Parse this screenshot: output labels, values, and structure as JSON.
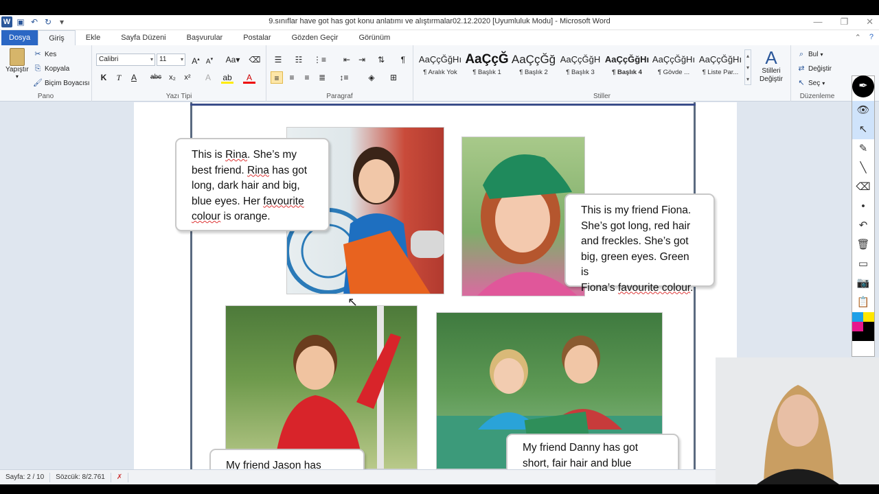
{
  "window": {
    "title": "9.sınıflar have got has got konu anlatımı ve alıştırmalar02.12.2020 [Uyumluluk Modu] - Microsoft Word"
  },
  "tabs": [
    "Dosya",
    "Giriş",
    "Ekle",
    "Sayfa Düzeni",
    "Başvurular",
    "Postalar",
    "Gözden Geçir",
    "Görünüm"
  ],
  "clipboard": {
    "paste": "Yapıştır",
    "cut": "Kes",
    "copy": "Kopyala",
    "format_painter": "Biçim Boyacısı",
    "label": "Pano"
  },
  "font": {
    "name": "Calibri",
    "size": "11",
    "label": "Yazı Tipi"
  },
  "paragraph": {
    "label": "Paragraf"
  },
  "styles": {
    "label": "Stiller",
    "items": [
      {
        "sample": "AaÇçĞğHı",
        "name": "¶ Aralık Yok"
      },
      {
        "sample": "AaÇçĞ",
        "name": "¶ Başlık 1"
      },
      {
        "sample": "AaÇçĞğ",
        "name": "¶ Başlık 2"
      },
      {
        "sample": "AaÇçĞğH",
        "name": "¶ Başlık 3"
      },
      {
        "sample": "AaÇçĞğHı",
        "name": "¶ Başlık 4"
      },
      {
        "sample": "AaÇçĞğHı",
        "name": "¶ Gövde ..."
      },
      {
        "sample": "AaÇçĞğHı",
        "name": "¶ Liste Par..."
      }
    ],
    "change_styles": "Stilleri Değiştir"
  },
  "editing": {
    "find": "Bul",
    "replace": "Değiştir",
    "select": "Seç",
    "label": "Düzenleme"
  },
  "document": {
    "rina": {
      "lines": [
        "This is Rina. She’s my",
        "best friend. Rina has got",
        "long, dark hair and big,",
        "blue eyes. Her favourite",
        "colour is orange."
      ]
    },
    "fiona": {
      "lines": [
        "This is my friend Fiona.",
        "She’s got long, red hair",
        "and freckles. She’s got",
        "big, green eyes. Green is",
        "Fiona’s favourite colour."
      ]
    },
    "jason": {
      "lines": [
        "My friend Jason  has"
      ]
    },
    "danny": {
      "lines": [
        "My friend Danny has got",
        "short, fair hair and blue"
      ]
    }
  },
  "status": {
    "page": "Sayfa: 2 / 10",
    "words": "Sözcük: 8/2.761"
  },
  "colors": {
    "file_tab": "#2b67c4",
    "ribbon_bg": "#f5f7fa",
    "doc_bg": "#dfe6ef",
    "frame": "#5a6a80"
  }
}
